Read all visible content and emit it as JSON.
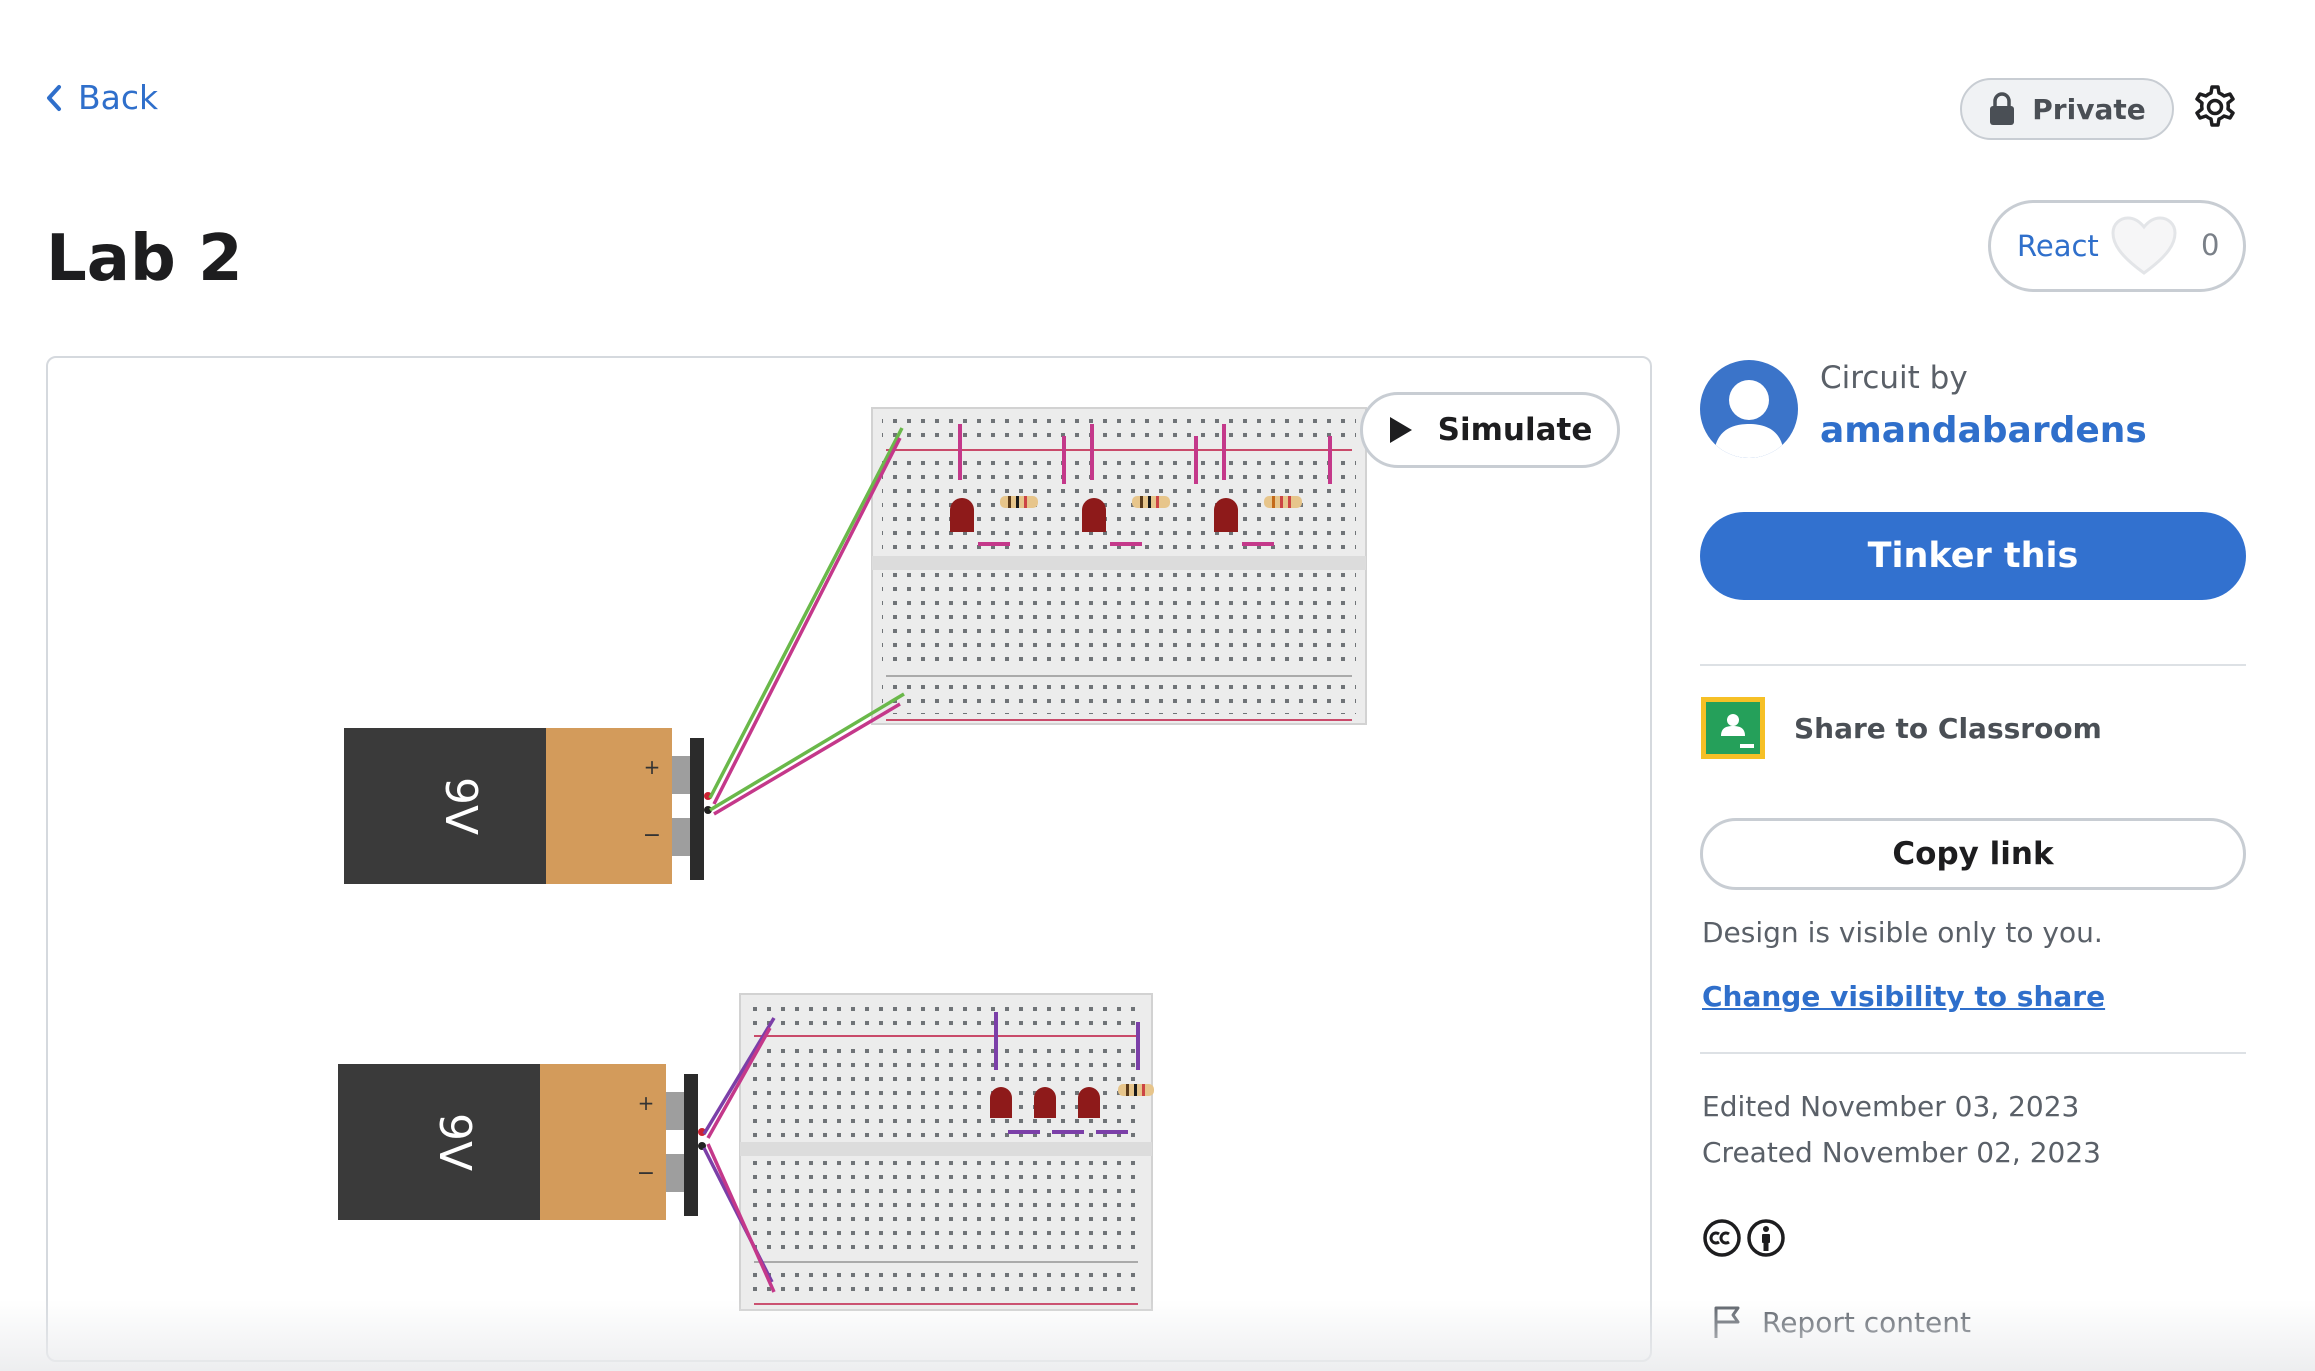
{
  "nav": {
    "back_label": "Back"
  },
  "header": {
    "title": "Lab 2",
    "privacy_label": "Private"
  },
  "react": {
    "label": "React",
    "count": "0"
  },
  "canvas": {
    "simulate_label": "Simulate",
    "battery_top_label": "9V",
    "battery_bottom_label": "9V",
    "plus": "+",
    "minus": "−"
  },
  "sidebar": {
    "circuit_by": "Circuit by",
    "author": "amandabardens",
    "tinker_label": "Tinker this",
    "share_classroom_label": "Share to Classroom",
    "copy_link_label": "Copy link",
    "visibility_note": "Design is visible only to you.",
    "change_visibility_label": "Change visibility to share",
    "edited": "Edited November 03, 2023",
    "created": "Created November 02, 2023",
    "report_label": "Report content"
  },
  "colors": {
    "accent": "#3271cf",
    "link": "#2f6fcb",
    "wire_pink": "#c4388a",
    "wire_green": "#6ab84a",
    "wire_purple": "#7b3fa8",
    "led": "#8e1a1a"
  },
  "icons": [
    "back-chevron-icon",
    "lock-icon",
    "gear-icon",
    "heart-icon",
    "play-icon",
    "user-icon",
    "google-classroom-icon",
    "cc-icon",
    "attribution-icon",
    "flag-icon"
  ]
}
